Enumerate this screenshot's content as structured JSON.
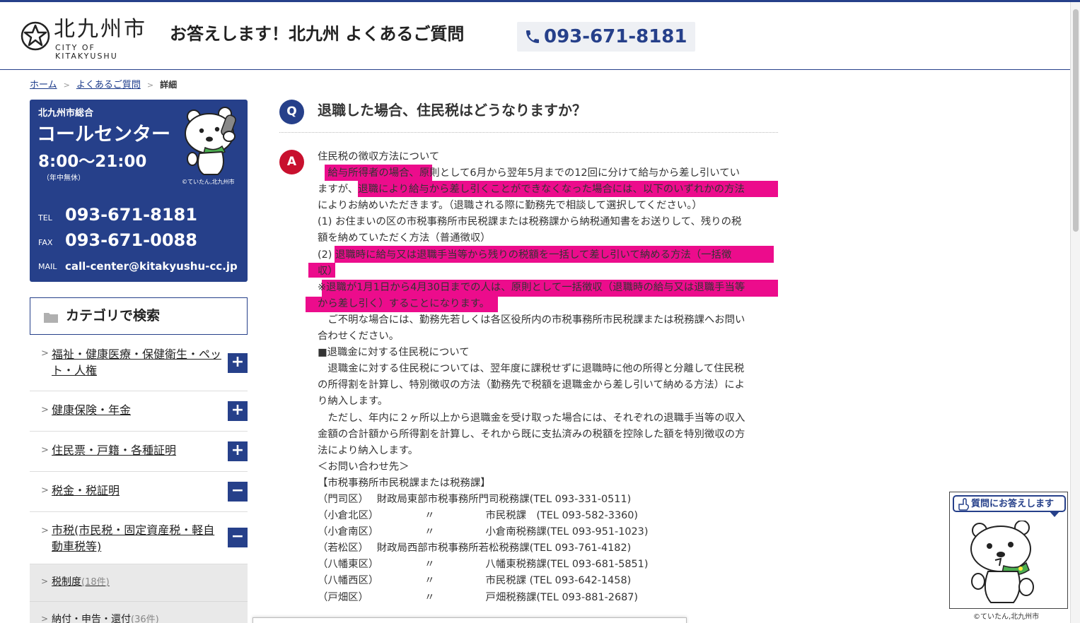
{
  "header": {
    "logo_jp": "北九州市",
    "logo_en": "CITY OF KITAKYUSHU",
    "site_title": "お答えします！北九州 よくあるご質問",
    "tel": "093-671-8181"
  },
  "breadcrumb": {
    "home": "ホーム",
    "faq": "よくあるご質問",
    "current": "詳細"
  },
  "call_center": {
    "org": "北九州市総合",
    "title": "コールセンター",
    "hours": "8:00～21:00",
    "note": "（年中無休）",
    "copyright": "©ていたん,北九州市",
    "tel_label": "TEL",
    "tel": "093-671-8181",
    "fax_label": "FAX",
    "fax": "093-671-0088",
    "mail_label": "MAIL",
    "mail": "call-center@kitakyushu-cc.jp"
  },
  "category_search": {
    "title": "カテゴリで検索",
    "items": [
      {
        "label": "福祉・健康医療・保健衛生・ペット・人権",
        "toggle": "+"
      },
      {
        "label": "健康保険・年金",
        "toggle": "+"
      },
      {
        "label": "住民票・戸籍・各種証明",
        "toggle": "+"
      },
      {
        "label": "税金・税証明",
        "toggle": "−"
      },
      {
        "label": "市税(市民税・固定資産税・軽自動車税等)",
        "toggle": "−"
      }
    ],
    "sub_items": [
      {
        "label": "税制度",
        "count": "(18件)"
      },
      {
        "label": "納付・申告・還付",
        "count": "(36件)"
      }
    ]
  },
  "faq": {
    "q_mark": "Q",
    "question": "退職した場合、住民税はどうなりますか？",
    "a_mark": "A",
    "answer_lines": [
      "住民税の徴収方法について",
      "　給与所得者の場合、原則として6月から翌年5月までの12回に分けて給与から差し引いてい",
      "ますが、退職により給与から差し引くことができなくなった場合には、以下のいずれかの方法",
      "によりお納めいただきます。（退職される際に勤務先で相談して選択してください。）",
      "(1) お住まいの区の市税事務所市民税課または税務課から納税通知書をお送りして、残りの税",
      "額を納めていただく方法（普通徴収）",
      "(2) 退職時に給与又は退職手当等から残りの税額を一括して差し引いて納める方法（一括徴",
      "収）",
      "※退職が1月1日から4月30日までの人は、原則として一括徴収（退職時の給与又は退職手当等",
      "から差し引く）することになります。",
      "　ご不明な場合には、勤務先若しくは各区役所内の市税事務所市民税課または税務課へお問い",
      "合わせください。",
      "■退職金に対する住民税について",
      "　退職金に対する住民税については、翌年度に課税せずに退職時に他の所得と分離して住民税",
      "の所得割を計算し、特別徴収の方法（勤務先で税額を退職金から差し引いて納める方法）によ",
      "り納入します。",
      "　ただし、年内に２ヶ所以上から退職金を受け取った場合には、それぞれの退職手当等の収入",
      "金額の合計額から所得割を計算し、それから既に支払済みの税額を控除した額を特別徴収の方",
      "法により納入します。",
      "＜お問い合わせ先＞",
      "【市税事務所市民税課または税務課】",
      "（門司区）　 財政局東部市税事務所門司税務課(TEL 093-331-0511)",
      "（小倉北区）　　　　　〃　　　　　市民税課　(TEL 093-582-3360)",
      "（小倉南区）　　　　　〃　　　　　小倉南税務課(TEL 093-951-1023)",
      "（若松区）　 財政局西部市税事務所若松税務課(TEL 093-761-4182)",
      "（八幡東区）　　　　　〃　　　　　八幡東税務課(TEL 093-681-5851)",
      "（八幡西区）　　　　　〃　　　　　市民税課 (TEL 093-642-1458)",
      "（戸畑区）　　　　　　〃　　　　　戸畑税務課(TEL 093-881-2687)"
    ]
  },
  "widget": {
    "bubble": "質問にお答えします",
    "copyright": "©ていたん,北九州市"
  },
  "colors": {
    "brand_navy": "#26408a",
    "answer_red": "#c8102e",
    "highlight_magenta": "#ec0c8c"
  }
}
